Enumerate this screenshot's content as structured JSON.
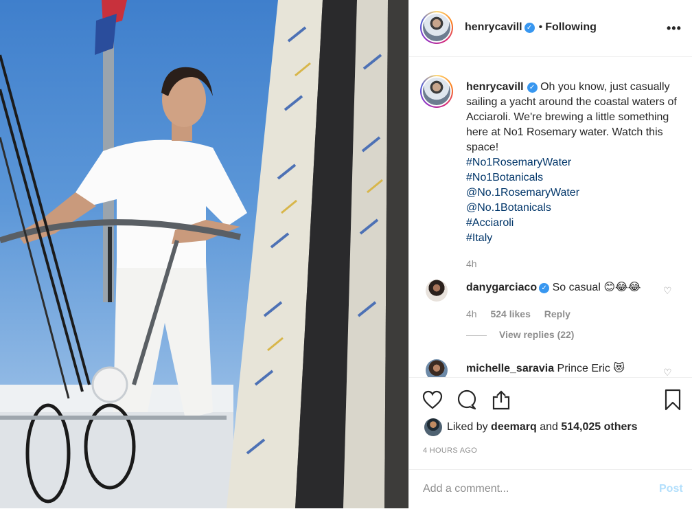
{
  "post": {
    "username": "henrycavill",
    "follow_separator": "•",
    "follow_status": "Following",
    "more_label": "•••",
    "caption_text": "Oh you know, just casually sailing a yacht around the coastal waters of Acciaroli. We're brewing a little something here at No1 Rosemary water. Watch this space!",
    "tags": [
      "#No1RosemaryWater",
      "#No1Botanicals",
      "@No.1RosemaryWater",
      "@No.1Botanicals",
      "#Acciaroli",
      "#Italy"
    ],
    "caption_time": "4h"
  },
  "comments": [
    {
      "username": "danygarciaco",
      "verified": true,
      "text": "So casual 😊😂😂",
      "time": "4h",
      "likes": "524 likes",
      "reply_label": "Reply",
      "view_replies": "View replies (22)"
    },
    {
      "username": "michelle_saravia",
      "text": "Prince Eric 😻"
    }
  ],
  "actions": {
    "liked_by_prefix": "Liked by",
    "liked_by_user": "deemarq",
    "liked_by_and": "and",
    "liked_by_others": "514,025 others",
    "posted_ago": "4 HOURS AGO",
    "add_comment_placeholder": "Add a comment...",
    "post_label": "Post"
  },
  "icons": [
    "verified-badge-icon",
    "more-options-icon",
    "heart-icon",
    "comment-icon",
    "share-icon",
    "bookmark-icon"
  ],
  "colors": {
    "link": "#003569",
    "muted": "#8e8e8e",
    "verified": "#3897f0",
    "post_disabled": "#b2dffc"
  }
}
